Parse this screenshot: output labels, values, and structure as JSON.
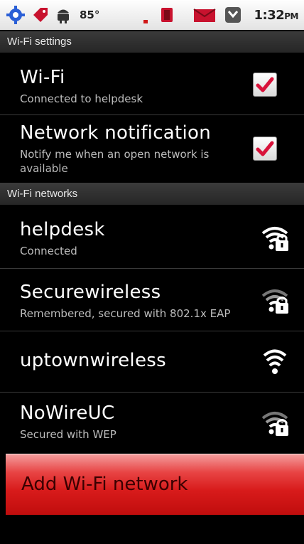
{
  "status_bar": {
    "temperature": "85°",
    "time": "1:32",
    "time_suffix": "PM",
    "icons": [
      "settings-gear-icon",
      "notification-tag-icon",
      "android-icon",
      "signal-icon",
      "battery-icon",
      "email-icon",
      "calendar-icon"
    ]
  },
  "wifi_settings": {
    "header": "Wi-Fi settings",
    "wifi": {
      "title": "Wi-Fi",
      "subtitle": "Connected to helpdesk",
      "checked": true
    },
    "network_notification": {
      "title": "Network notification",
      "subtitle_line1": "Notify me when an open network is",
      "subtitle_line2": "available",
      "checked": true
    }
  },
  "wifi_networks": {
    "header": "Wi-Fi networks",
    "networks": [
      {
        "name": "helpdesk",
        "status": "Connected",
        "secured": true,
        "icon": "wifi-lock-icon"
      },
      {
        "name": "Securewireless",
        "status": "Remembered, secured with 802.1x EAP",
        "secured": true,
        "icon": "wifi-lock-icon"
      },
      {
        "name": "uptownwireless",
        "status": "",
        "secured": false,
        "icon": "wifi-icon"
      },
      {
        "name": "NoWireUC",
        "status": "Secured with WEP",
        "secured": true,
        "icon": "wifi-lock-icon"
      }
    ]
  },
  "add_network": {
    "label": "Add Wi-Fi network"
  },
  "colors": {
    "checkmark": "#d8123a",
    "accent_red": "#d81b1b"
  }
}
